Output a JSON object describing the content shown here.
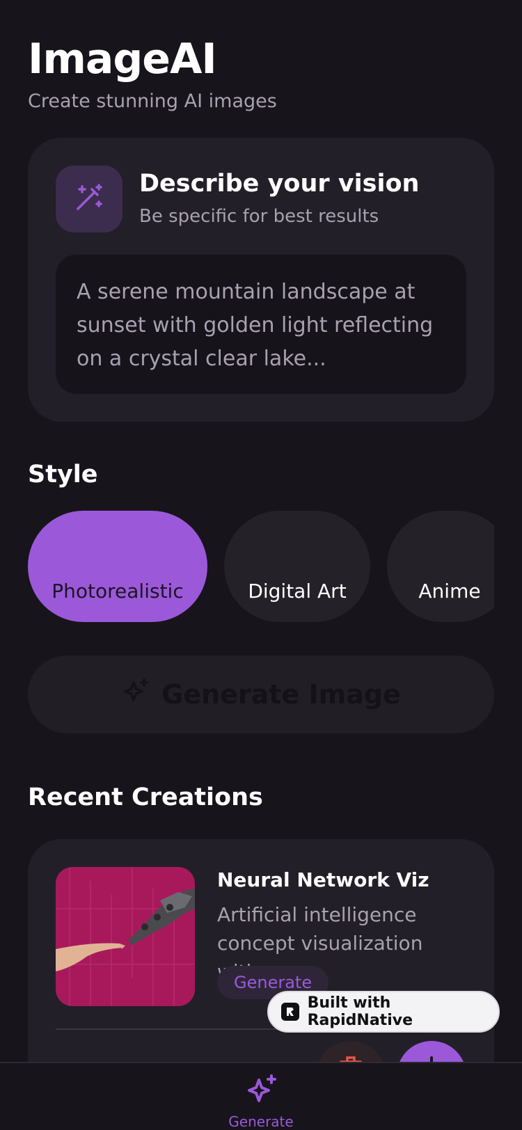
{
  "header": {
    "title": "ImageAI",
    "subtitle": "Create stunning AI images"
  },
  "prompt": {
    "heading": "Describe your vision",
    "hint": "Be specific for best results",
    "placeholder": "A serene mountain landscape at sunset with golden light reflecting on a crystal clear lake...",
    "icon": "magic-wand-icon"
  },
  "style": {
    "heading": "Style",
    "options": [
      "Photorealistic",
      "Digital Art",
      "Anime"
    ],
    "selected": "Photorealistic"
  },
  "generate_button": {
    "label": "Generate Image",
    "icon": "sparkle-icon"
  },
  "recent": {
    "heading": "Recent Creations",
    "items": [
      {
        "title": "Neural Network Viz",
        "description": "Artificial intelligence concept visualization with...",
        "tag": "Generate"
      }
    ]
  },
  "badge": {
    "label": "Built with RapidNative"
  },
  "tabbar": {
    "generate_label": "Generate"
  },
  "colors": {
    "accent": "#9b59d9",
    "background": "#18141c",
    "card": "#231f29",
    "muted_text": "#a8a1b0",
    "danger": "#e0564a"
  }
}
